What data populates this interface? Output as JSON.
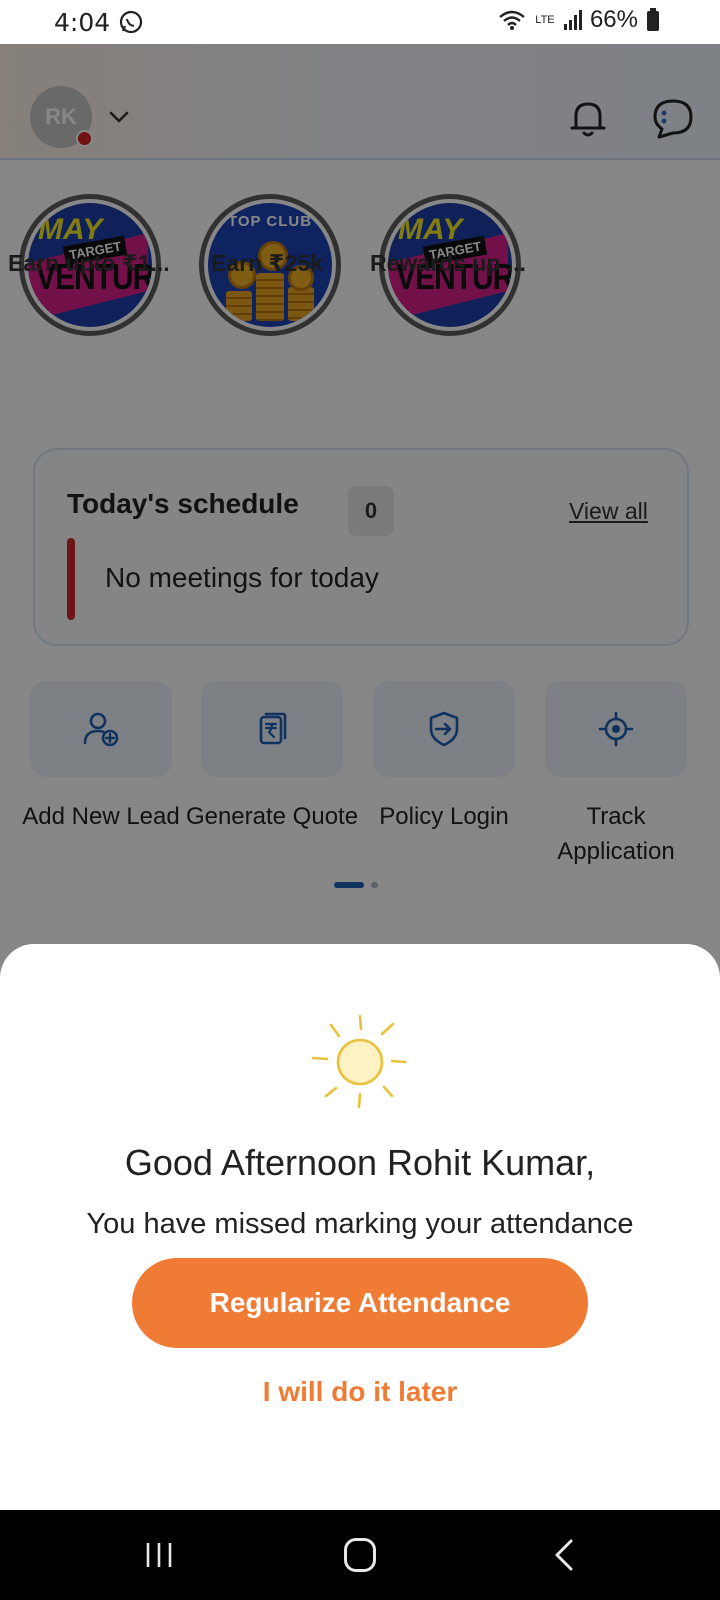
{
  "status_bar": {
    "time": "4:04",
    "battery": "66%",
    "network": "LTE"
  },
  "header": {
    "avatar_initials": "RK"
  },
  "stories": [
    {
      "label": "Earn upto ₹1...",
      "image": "may-target-venture",
      "badge_top": "MAY",
      "badge_mid": "TARGET",
      "badge_main": "VENTURE"
    },
    {
      "label": "Earn ₹25k",
      "image": "top-club-coins",
      "badge_top": "TOP CLUB"
    },
    {
      "label": "Rewards up ...",
      "image": "may-target-venture",
      "badge_top": "MAY",
      "badge_mid": "TARGET",
      "badge_main": "VENTURE"
    }
  ],
  "schedule": {
    "title": "Today's schedule",
    "count": "0",
    "view_all": "View all",
    "empty_text": "No meetings for today"
  },
  "actions": [
    {
      "label": "Add New Lead",
      "icon": "add-user-icon"
    },
    {
      "label": "Generate Quote",
      "icon": "rupee-document-icon"
    },
    {
      "label": "Policy Login",
      "icon": "shield-login-icon"
    },
    {
      "label": "Track Application",
      "icon": "location-target-icon"
    }
  ],
  "attendance_sheet": {
    "greeting": "Good Afternoon Rohit Kumar,",
    "message": "You have missed marking your attendance",
    "primary_button": "Regularize Attendance",
    "secondary_link": "I will do it later"
  },
  "colors": {
    "accent": "#f07b34",
    "primary_blue": "#1f5fb3",
    "danger": "#d02a2a"
  }
}
